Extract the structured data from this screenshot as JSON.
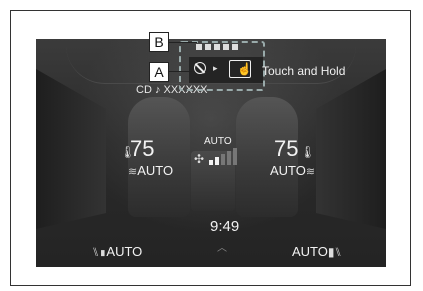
{
  "callouts": {
    "b": "B",
    "a": "A"
  },
  "overlay": {
    "touch_and_hold": "Touch and Hold"
  },
  "media": {
    "now_playing": "CD ♪ XXXXXX"
  },
  "climate": {
    "driver_temp": "75",
    "passenger_temp": "75",
    "driver_mode": "AUTO",
    "passenger_mode": "AUTO",
    "fan_mode": "AUTO",
    "fan_level_fraction": 0.4
  },
  "clock": "9:49",
  "seats": {
    "left_mode": "AUTO",
    "right_mode": "AUTO"
  },
  "icons": {
    "thermometer": "thermometer-icon",
    "fan": "fan-icon",
    "seat_heat": "seat-heat-icon"
  }
}
